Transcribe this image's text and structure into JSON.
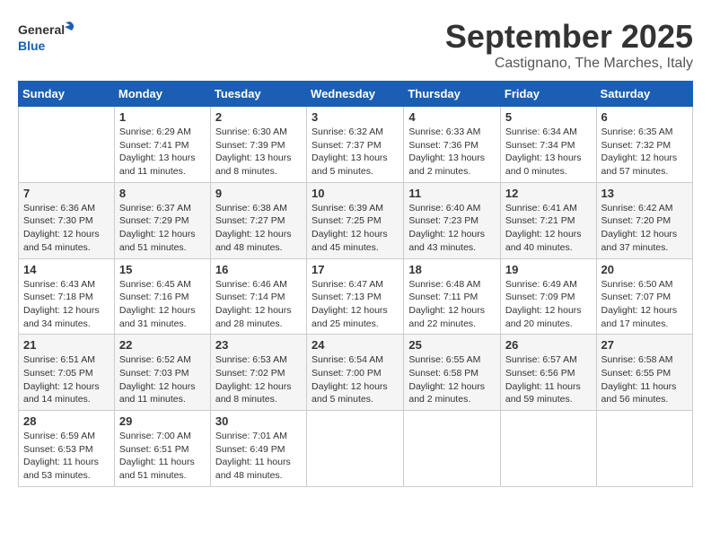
{
  "header": {
    "logo_general": "General",
    "logo_blue": "Blue",
    "month_year": "September 2025",
    "location": "Castignano, The Marches, Italy"
  },
  "days_of_week": [
    "Sunday",
    "Monday",
    "Tuesday",
    "Wednesday",
    "Thursday",
    "Friday",
    "Saturday"
  ],
  "weeks": [
    [
      {
        "day": "",
        "info": ""
      },
      {
        "day": "1",
        "info": "Sunrise: 6:29 AM\nSunset: 7:41 PM\nDaylight: 13 hours\nand 11 minutes."
      },
      {
        "day": "2",
        "info": "Sunrise: 6:30 AM\nSunset: 7:39 PM\nDaylight: 13 hours\nand 8 minutes."
      },
      {
        "day": "3",
        "info": "Sunrise: 6:32 AM\nSunset: 7:37 PM\nDaylight: 13 hours\nand 5 minutes."
      },
      {
        "day": "4",
        "info": "Sunrise: 6:33 AM\nSunset: 7:36 PM\nDaylight: 13 hours\nand 2 minutes."
      },
      {
        "day": "5",
        "info": "Sunrise: 6:34 AM\nSunset: 7:34 PM\nDaylight: 13 hours\nand 0 minutes."
      },
      {
        "day": "6",
        "info": "Sunrise: 6:35 AM\nSunset: 7:32 PM\nDaylight: 12 hours\nand 57 minutes."
      }
    ],
    [
      {
        "day": "7",
        "info": "Sunrise: 6:36 AM\nSunset: 7:30 PM\nDaylight: 12 hours\nand 54 minutes."
      },
      {
        "day": "8",
        "info": "Sunrise: 6:37 AM\nSunset: 7:29 PM\nDaylight: 12 hours\nand 51 minutes."
      },
      {
        "day": "9",
        "info": "Sunrise: 6:38 AM\nSunset: 7:27 PM\nDaylight: 12 hours\nand 48 minutes."
      },
      {
        "day": "10",
        "info": "Sunrise: 6:39 AM\nSunset: 7:25 PM\nDaylight: 12 hours\nand 45 minutes."
      },
      {
        "day": "11",
        "info": "Sunrise: 6:40 AM\nSunset: 7:23 PM\nDaylight: 12 hours\nand 43 minutes."
      },
      {
        "day": "12",
        "info": "Sunrise: 6:41 AM\nSunset: 7:21 PM\nDaylight: 12 hours\nand 40 minutes."
      },
      {
        "day": "13",
        "info": "Sunrise: 6:42 AM\nSunset: 7:20 PM\nDaylight: 12 hours\nand 37 minutes."
      }
    ],
    [
      {
        "day": "14",
        "info": "Sunrise: 6:43 AM\nSunset: 7:18 PM\nDaylight: 12 hours\nand 34 minutes."
      },
      {
        "day": "15",
        "info": "Sunrise: 6:45 AM\nSunset: 7:16 PM\nDaylight: 12 hours\nand 31 minutes."
      },
      {
        "day": "16",
        "info": "Sunrise: 6:46 AM\nSunset: 7:14 PM\nDaylight: 12 hours\nand 28 minutes."
      },
      {
        "day": "17",
        "info": "Sunrise: 6:47 AM\nSunset: 7:13 PM\nDaylight: 12 hours\nand 25 minutes."
      },
      {
        "day": "18",
        "info": "Sunrise: 6:48 AM\nSunset: 7:11 PM\nDaylight: 12 hours\nand 22 minutes."
      },
      {
        "day": "19",
        "info": "Sunrise: 6:49 AM\nSunset: 7:09 PM\nDaylight: 12 hours\nand 20 minutes."
      },
      {
        "day": "20",
        "info": "Sunrise: 6:50 AM\nSunset: 7:07 PM\nDaylight: 12 hours\nand 17 minutes."
      }
    ],
    [
      {
        "day": "21",
        "info": "Sunrise: 6:51 AM\nSunset: 7:05 PM\nDaylight: 12 hours\nand 14 minutes."
      },
      {
        "day": "22",
        "info": "Sunrise: 6:52 AM\nSunset: 7:03 PM\nDaylight: 12 hours\nand 11 minutes."
      },
      {
        "day": "23",
        "info": "Sunrise: 6:53 AM\nSunset: 7:02 PM\nDaylight: 12 hours\nand 8 minutes."
      },
      {
        "day": "24",
        "info": "Sunrise: 6:54 AM\nSunset: 7:00 PM\nDaylight: 12 hours\nand 5 minutes."
      },
      {
        "day": "25",
        "info": "Sunrise: 6:55 AM\nSunset: 6:58 PM\nDaylight: 12 hours\nand 2 minutes."
      },
      {
        "day": "26",
        "info": "Sunrise: 6:57 AM\nSunset: 6:56 PM\nDaylight: 11 hours\nand 59 minutes."
      },
      {
        "day": "27",
        "info": "Sunrise: 6:58 AM\nSunset: 6:55 PM\nDaylight: 11 hours\nand 56 minutes."
      }
    ],
    [
      {
        "day": "28",
        "info": "Sunrise: 6:59 AM\nSunset: 6:53 PM\nDaylight: 11 hours\nand 53 minutes."
      },
      {
        "day": "29",
        "info": "Sunrise: 7:00 AM\nSunset: 6:51 PM\nDaylight: 11 hours\nand 51 minutes."
      },
      {
        "day": "30",
        "info": "Sunrise: 7:01 AM\nSunset: 6:49 PM\nDaylight: 11 hours\nand 48 minutes."
      },
      {
        "day": "",
        "info": ""
      },
      {
        "day": "",
        "info": ""
      },
      {
        "day": "",
        "info": ""
      },
      {
        "day": "",
        "info": ""
      }
    ]
  ]
}
